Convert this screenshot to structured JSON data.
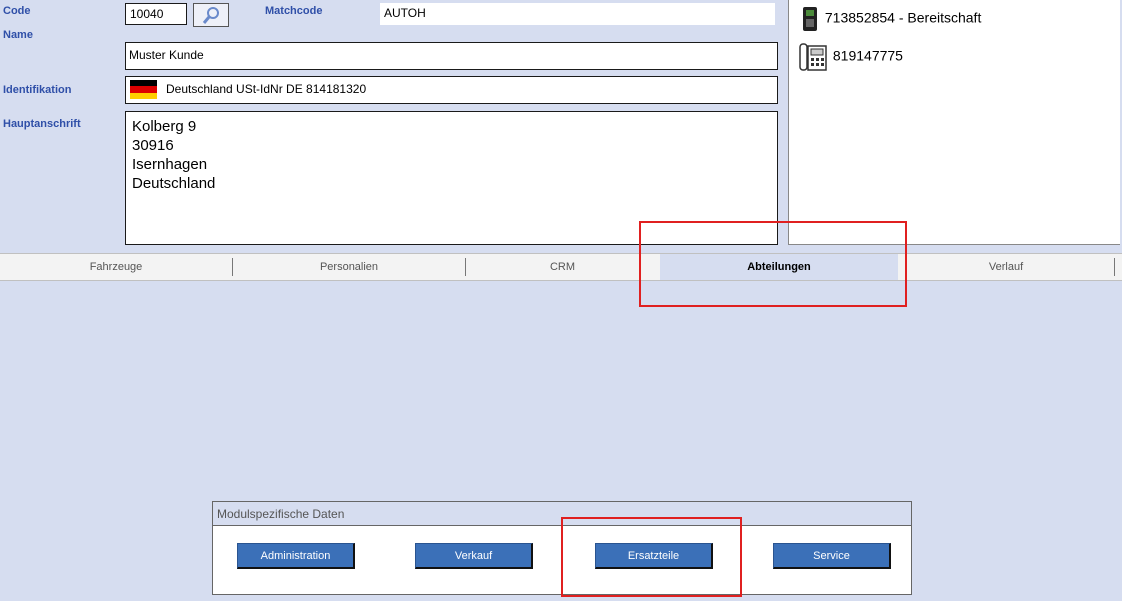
{
  "fields": {
    "code_label": "Code",
    "code_value": "10040",
    "matchcode_label": "Matchcode",
    "matchcode_value": "AUTOH",
    "name_label": "Name",
    "name_value": "Muster Kunde",
    "ident_label": "Identifikation",
    "ident_value": "Deutschland USt-IdNr DE  814181320",
    "address_label": "Hauptanschrift",
    "address_lines": [
      "Kolberg 9",
      "30916",
      "Isernhagen",
      "Deutschland"
    ]
  },
  "phones": [
    {
      "icon": "mobile-phone-icon",
      "text": "713852854 - Bereitschaft"
    },
    {
      "icon": "desk-phone-icon",
      "text": "819147775"
    }
  ],
  "tabs": [
    {
      "label": "Fahrzeuge",
      "active": false
    },
    {
      "label": "Personalien",
      "active": false
    },
    {
      "label": "CRM",
      "active": false
    },
    {
      "label": "Abteilungen",
      "active": true
    },
    {
      "label": "Verlauf",
      "active": false
    }
  ],
  "module": {
    "title": "Modulspezifische Daten",
    "buttons": [
      "Administration",
      "Verkauf",
      "Ersatzteile",
      "Service"
    ]
  },
  "colors": {
    "background": "#d6ddf0",
    "label": "#2f4fa8",
    "highlight": "#e02020",
    "button": "#3b70b8"
  }
}
